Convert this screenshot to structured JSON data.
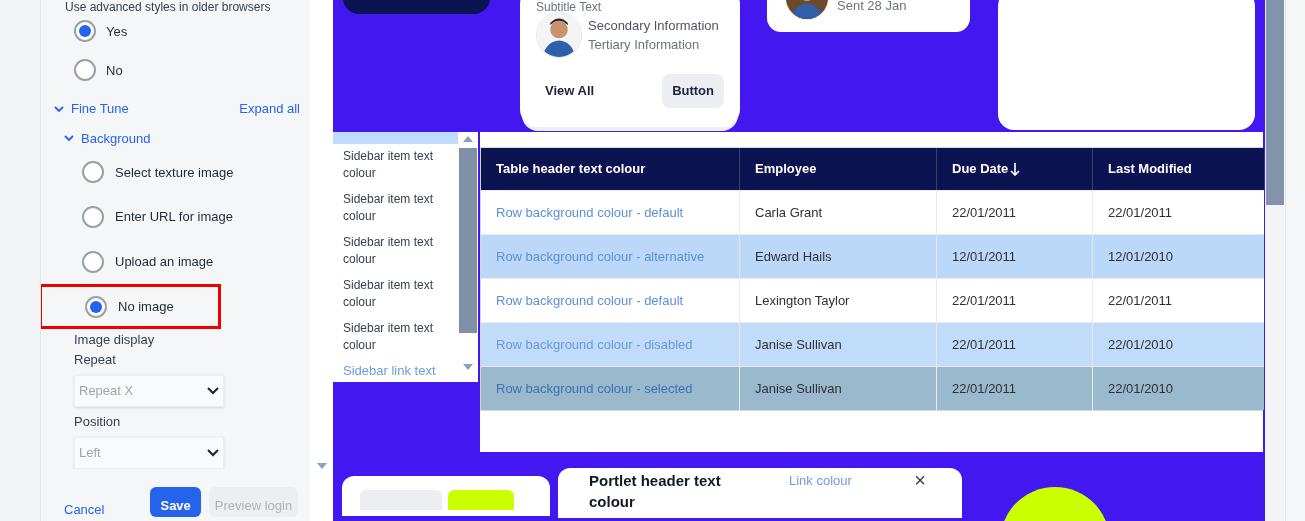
{
  "settings": {
    "heading": "Use advanced styles in older browsers",
    "options": [
      {
        "label": "Yes",
        "selected": true
      },
      {
        "label": "No",
        "selected": false
      }
    ],
    "fine_tune": {
      "label": "Fine Tune",
      "expanded": true,
      "action": "Expand all"
    },
    "background": {
      "label": "Background",
      "expanded": true,
      "options": [
        {
          "label": "Select texture image",
          "selected": false,
          "highlighted": false
        },
        {
          "label": "Enter URL for image",
          "selected": false,
          "highlighted": false
        },
        {
          "label": "Upload an image",
          "selected": false,
          "highlighted": false
        },
        {
          "label": "No image",
          "selected": true,
          "highlighted": true
        }
      ]
    },
    "image_display": {
      "label": "Image display",
      "fields": [
        {
          "label": "Repeat",
          "value": "Repeat X",
          "disabled": true
        },
        {
          "label": "Position",
          "value": "Left",
          "disabled": true
        }
      ]
    },
    "footer": [
      {
        "label": "Cancel",
        "kind": "link",
        "disabled": false
      },
      {
        "label": "Save",
        "kind": "primary",
        "disabled": false
      },
      {
        "label": "Preview login",
        "kind": "secondary",
        "disabled": true
      }
    ]
  },
  "preview": {
    "profile_card": {
      "subtitle": "Subtitle Text",
      "secondary": "Secondary Information",
      "tertiary": "Tertiary Information",
      "link": "View All",
      "button": "Button"
    },
    "message_card": {
      "meta": "Sent 28 Jan"
    },
    "sidebar": {
      "items": [
        "Sidebar item text colour",
        "Sidebar item text colour",
        "Sidebar item text colour",
        "Sidebar item text colour",
        "Sidebar item text colour"
      ],
      "link": "Sidebar link text"
    },
    "table": {
      "columns": [
        {
          "label": "Table header text colour",
          "sorted": false
        },
        {
          "label": "Employee",
          "sorted": false
        },
        {
          "label": "Due Date",
          "sorted": true
        },
        {
          "label": "Last Modified",
          "sorted": false
        }
      ],
      "rows": [
        {
          "kind": "default",
          "cells": [
            "Row background colour - default",
            "Carla Grant",
            "22/01/2011",
            "22/01/2011"
          ]
        },
        {
          "kind": "alternative",
          "cells": [
            "Row background colour - alternative",
            "Edward Hails",
            "12/01/2011",
            "12/01/2010"
          ]
        },
        {
          "kind": "default",
          "cells": [
            "Row background colour - default",
            "Lexington Taylor",
            "22/01/2011",
            "22/01/2011"
          ]
        },
        {
          "kind": "disabled",
          "cells": [
            "Row background colour - disabled",
            "Janise Sullivan",
            "22/01/2011",
            "22/01/2010"
          ]
        },
        {
          "kind": "selected",
          "cells": [
            "Row background colour - selected",
            "Janise Sullivan",
            "22/01/2011",
            "22/01/2010"
          ]
        }
      ]
    },
    "portlet": {
      "title": "Portlet header text colour",
      "link": "Link colour",
      "close": "×"
    }
  }
}
